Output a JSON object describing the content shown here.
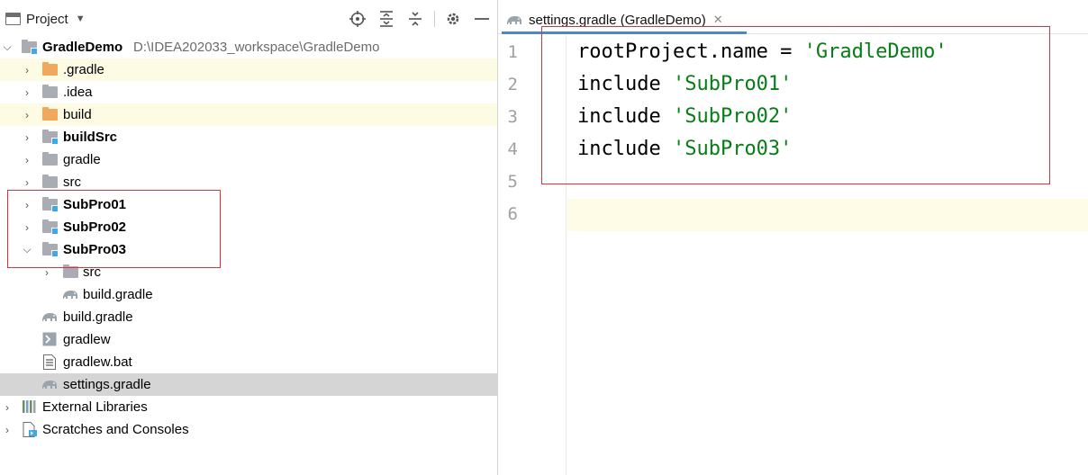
{
  "project_panel": {
    "title": "Project",
    "tools": [
      "crosshair-icon",
      "expand-all-icon",
      "collapse-all-icon",
      "gear-icon",
      "minimize-icon"
    ],
    "tree": [
      {
        "label": "GradleDemo",
        "path": "D:\\IDEA202033_workspace\\GradleDemo",
        "bold": true
      },
      {
        "label": ".gradle"
      },
      {
        "label": ".idea"
      },
      {
        "label": "build"
      },
      {
        "label": "buildSrc",
        "bold": true
      },
      {
        "label": "gradle"
      },
      {
        "label": "src"
      },
      {
        "label": "SubPro01",
        "bold": true
      },
      {
        "label": "SubPro02",
        "bold": true
      },
      {
        "label": "SubPro03",
        "bold": true
      },
      {
        "label": "src"
      },
      {
        "label": "build.gradle"
      },
      {
        "label": "build.gradle"
      },
      {
        "label": "gradlew"
      },
      {
        "label": "gradlew.bat"
      },
      {
        "label": "settings.gradle"
      },
      {
        "label": "External Libraries"
      },
      {
        "label": "Scratches and Consoles"
      }
    ]
  },
  "editor": {
    "tab_label": "settings.gradle (GradleDemo)",
    "line_numbers": [
      "1",
      "2",
      "3",
      "4",
      "5",
      "6"
    ],
    "lines": [
      {
        "code": "rootProject.name = ",
        "string": "'GradleDemo'"
      },
      {
        "code": "include ",
        "string": "'SubPro01'"
      },
      {
        "code": "include ",
        "string": "'SubPro02'"
      },
      {
        "code": "include ",
        "string": "'SubPro03'"
      }
    ]
  },
  "colors": {
    "string_literal": "#067d17",
    "highlight_box": "#e0303a",
    "module_badge": "#40a7e8",
    "tab_underline": "#4a88c7"
  }
}
